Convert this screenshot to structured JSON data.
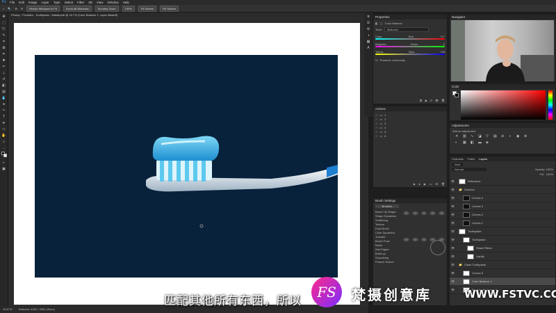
{
  "menu": {
    "items": [
      "File",
      "Edit",
      "Image",
      "Layer",
      "Type",
      "Select",
      "Filter",
      "3D",
      "View",
      "Window",
      "Help"
    ]
  },
  "options_bar": {
    "buttons": [
      "Resize Windows to Fit",
      "Zoom All Windows",
      "Scrubby Zoom",
      "100%",
      "Fit Screen",
      "Fill Screen"
    ]
  },
  "document": {
    "tab_title": "Photop - Proclaim - Toothpaste - Masterpsb @ 16.7% (Color Balance 1, Layer Mask/8)"
  },
  "status": {
    "zoom": "16.67%",
    "info": "Artboard: 4000 / 3000 (30cm)"
  },
  "properties": {
    "title": "Properties",
    "subtitle": "Color Balance",
    "tone_label": "Tone:",
    "tone_value": "Midtones",
    "sliders": [
      {
        "left": "Cyan",
        "right": "Red",
        "value": "+17"
      },
      {
        "left": "Magenta",
        "right": "Green",
        "value": "-2"
      },
      {
        "left": "Yellow",
        "right": "Blue",
        "value": "+48"
      }
    ],
    "preserve": "Preserve Luminosity"
  },
  "actions": {
    "title": "Actions",
    "items": [
      "1",
      "2",
      "3",
      "4",
      "5",
      "6"
    ]
  },
  "brush": {
    "title": "Brush Settings",
    "presets_label": "Brushes",
    "options": [
      "Brush Tip Shape",
      "Shape Dynamics",
      "Scattering",
      "Texture",
      "Dual Brush",
      "Color Dynamics",
      "Transfer",
      "Brush Pose",
      "Noise",
      "Wet Edges",
      "Build-up",
      "Smoothing",
      "Protect Texture"
    ]
  },
  "navigator": {
    "title": "Navigator"
  },
  "color": {
    "title": "Color"
  },
  "adjustments": {
    "title": "Adjustments",
    "hint": "Add an adjustment"
  },
  "layers": {
    "tabs": [
      "Channels",
      "Paths",
      "Layers"
    ],
    "kind": "Kind",
    "blend": "Normal",
    "opacity_label": "Opacity:",
    "opacity": "100%",
    "fill_label": "Fill:",
    "fill": "100%",
    "items": [
      {
        "name": "Reference",
        "indent": 0,
        "dark": false
      },
      {
        "name": "Sources",
        "indent": 0,
        "dark": false,
        "group": true
      },
      {
        "name": "Curves 4",
        "indent": 1,
        "dark": true
      },
      {
        "name": "Curves 3",
        "indent": 1,
        "dark": true
      },
      {
        "name": "Curves 2",
        "indent": 1,
        "dark": true
      },
      {
        "name": "Curves 1",
        "indent": 1,
        "dark": true
      },
      {
        "name": "Toothpaste",
        "indent": 0,
        "dark": false
      },
      {
        "name": "Toothpaste",
        "indent": 1,
        "dark": false
      },
      {
        "name": "Smart Filters",
        "indent": 2,
        "dark": false
      },
      {
        "name": "Liquify",
        "indent": 2,
        "dark": false
      },
      {
        "name": "Clean Toothpaste",
        "indent": 0,
        "dark": false,
        "group": true
      },
      {
        "name": "Curves 5",
        "indent": 1,
        "dark": false
      },
      {
        "name": "Color Balance 1",
        "indent": 1,
        "dark": false,
        "selected": true
      },
      {
        "name": "Brushtooth Curves 1",
        "indent": 1,
        "dark": false
      }
    ]
  },
  "subtitle": "匹配其他所有东西，所以",
  "watermark": {
    "logo": "FS",
    "brand": "梵摄创意库",
    "url": "WWW.FSTVC.CC"
  }
}
